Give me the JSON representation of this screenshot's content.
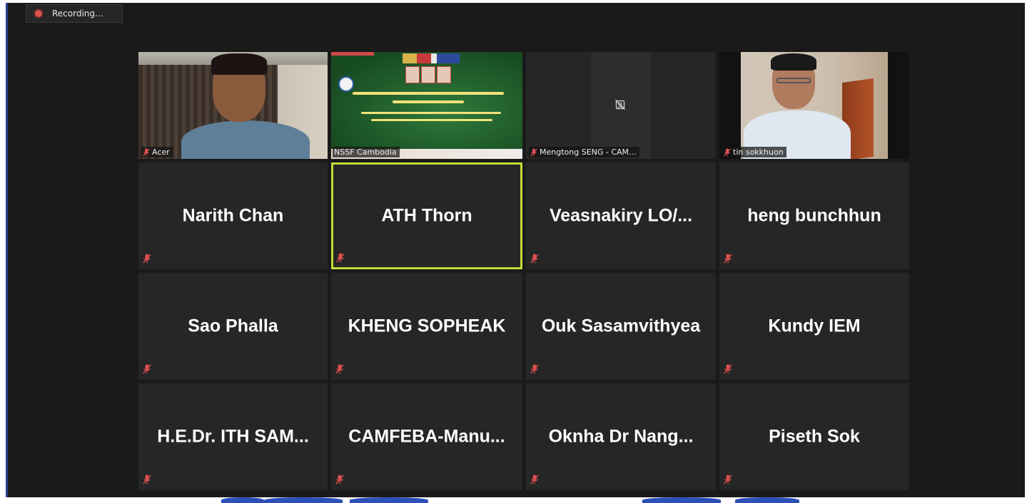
{
  "recording": {
    "label": "Recording..."
  },
  "video_tiles": [
    {
      "name": "Acer",
      "muted": true
    },
    {
      "name": "NSSF Cambodia",
      "muted": false
    },
    {
      "name": "Mengtong SENG - CAM...",
      "muted": true
    },
    {
      "name": "tin sokkhuon",
      "muted": true
    }
  ],
  "participants": [
    {
      "name": "Narith Chan",
      "muted": true,
      "active_speaker": false
    },
    {
      "name": "ATH Thorn",
      "muted": true,
      "active_speaker": true
    },
    {
      "name": "Veasnakiry  LO/...",
      "muted": true,
      "active_speaker": false
    },
    {
      "name": "heng bunchhun",
      "muted": true,
      "active_speaker": false
    },
    {
      "name": "Sao Phalla",
      "muted": true,
      "active_speaker": false
    },
    {
      "name": "KHENG SOPHEAK",
      "muted": true,
      "active_speaker": false
    },
    {
      "name": "Ouk Sasamvithyea",
      "muted": true,
      "active_speaker": false
    },
    {
      "name": "Kundy IEM",
      "muted": true,
      "active_speaker": false
    },
    {
      "name": "H.E.Dr. ITH SAM...",
      "muted": true,
      "active_speaker": false
    },
    {
      "name": "CAMFEBA-Manu...",
      "muted": true,
      "active_speaker": false
    },
    {
      "name": "Oknha Dr Nang...",
      "muted": true,
      "active_speaker": false
    },
    {
      "name": "Piseth Sok",
      "muted": true,
      "active_speaker": false
    }
  ],
  "colors": {
    "background": "#1a1a1a",
    "tile": "#262626",
    "active_border": "#c7d93a",
    "mute": "#e05050",
    "recording_dot": "#d9534f"
  }
}
